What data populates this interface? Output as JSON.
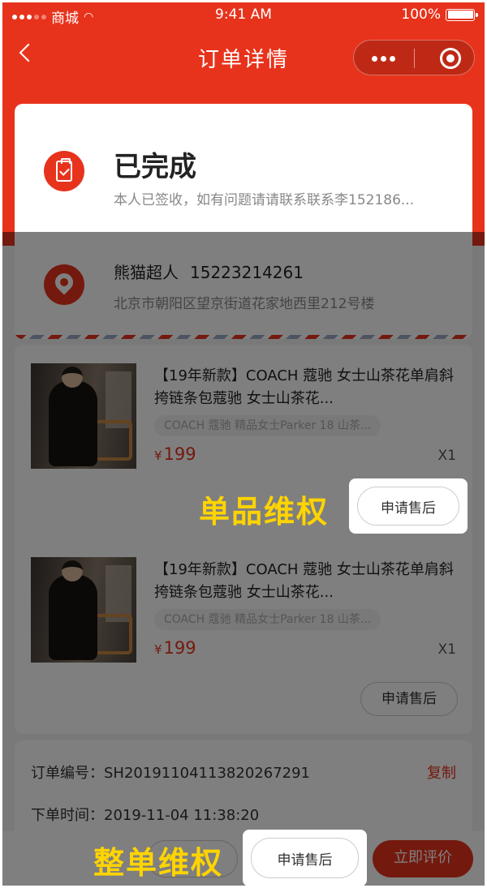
{
  "status_bar": {
    "carrier": "商城",
    "time": "9:41 AM",
    "battery": "100%"
  },
  "nav": {
    "title": "订单详情"
  },
  "order_status": {
    "title": "已完成",
    "description": "本人已签收，如有问题请请联系联系李152186..."
  },
  "address": {
    "name": "熊猫超人",
    "phone": "15223214261",
    "detail": "北京市朝阳区望京街道花家地西里212号楼"
  },
  "items": [
    {
      "title": "【19年新款】COACH 蔻驰 女士山茶花单肩斜挎链条包蔻驰 女士山茶花...",
      "sku": "COACH 蔻驰 精品女士Parker 18 山茶...",
      "currency": "¥",
      "price": "199",
      "quantity": "X1",
      "after_sale_label": "申请售后"
    },
    {
      "title": "【19年新款】COACH 蔻驰 女士山茶花单肩斜挎链条包蔻驰 女士山茶花...",
      "sku": "COACH 蔻驰 精品女士Parker 18 山茶...",
      "currency": "¥",
      "price": "199",
      "quantity": "X1",
      "after_sale_label": "申请售后"
    }
  ],
  "order_info": {
    "order_no_label": "订单编号：",
    "order_no": "SH20191104113820267291",
    "copy_label": "复制",
    "order_time_label": "下单时间：",
    "order_time": "2019-11-04 11:38:20"
  },
  "bottom_bar": {
    "after_sale_label": "申请售后",
    "review_label": "立即评价"
  },
  "annotations": {
    "single_item": "单品维权",
    "whole_order": "整单维权"
  },
  "colors": {
    "brand": "#e8331c",
    "callout": "#ffd400"
  }
}
